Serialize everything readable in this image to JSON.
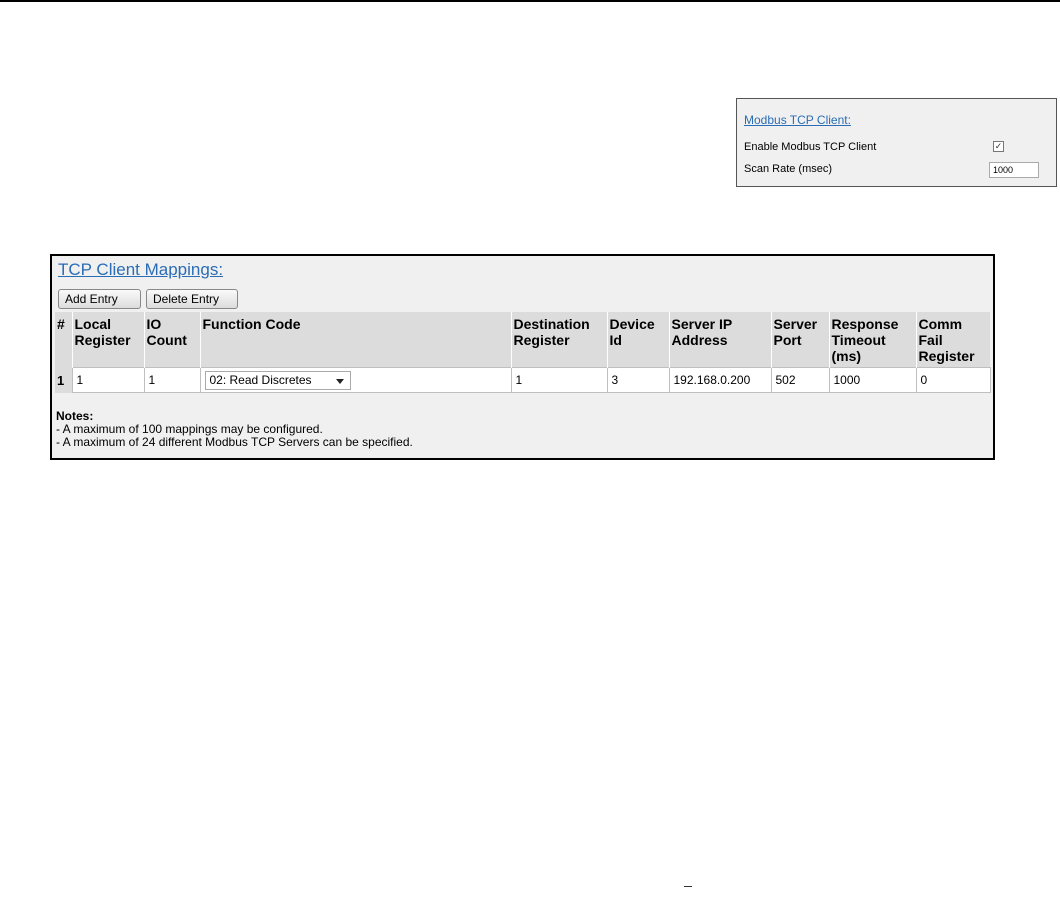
{
  "client": {
    "title": "Modbus TCP Client:",
    "enable_label": "Enable Modbus TCP Client",
    "enable_checked": true,
    "scan_label": "Scan Rate (msec)",
    "scan_value": "1000"
  },
  "mappings": {
    "title": "TCP Client Mappings:",
    "add_label": "Add Entry",
    "delete_label": "Delete Entry",
    "headers": [
      "#",
      "Local Register",
      "IO Count",
      "Function Code",
      "Destination Register",
      "Device Id",
      "Server IP Address",
      "Server Port",
      "Response Timeout (ms)",
      "Comm Fail Register"
    ],
    "rows": [
      {
        "num": "1",
        "local_register": "1",
        "io_count": "1",
        "function_code": "02: Read Discretes",
        "destination_register": "1",
        "device_id": "3",
        "server_ip": "192.168.0.200",
        "server_port": "502",
        "response_timeout": "1000",
        "comm_fail_register": "0"
      }
    ],
    "notes_heading": "Notes:",
    "notes": [
      " - A maximum of 100 mappings may be configured.",
      " - A maximum of 24 different Modbus TCP Servers can be specified."
    ]
  }
}
